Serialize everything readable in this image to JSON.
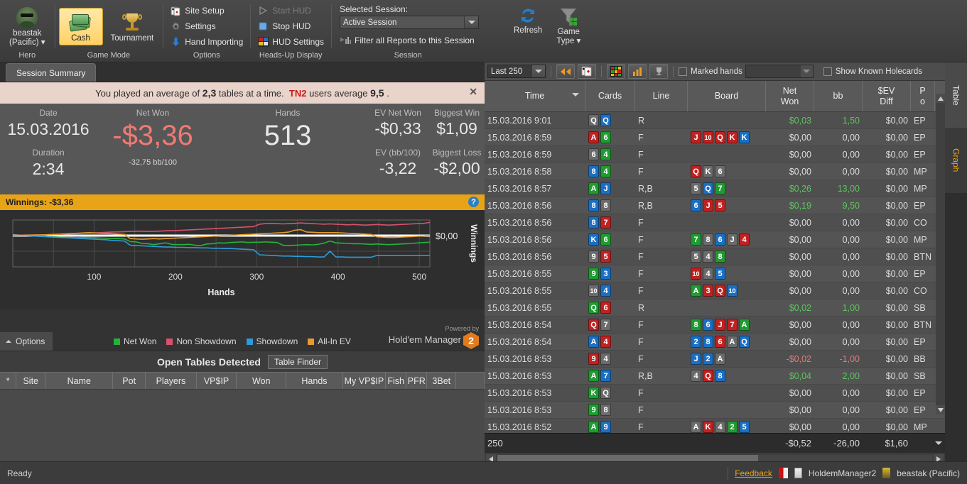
{
  "ribbon": {
    "hero": {
      "name": "beastak",
      "site": "(Pacific)",
      "group": "Hero"
    },
    "game_mode": {
      "group": "Game Mode",
      "cash": "Cash",
      "tournament": "Tournament"
    },
    "options": {
      "group": "Options",
      "site_setup": "Site Setup",
      "settings": "Settings",
      "hand_importing": "Hand Importing"
    },
    "hud": {
      "group": "Heads-Up Display",
      "start": "Start HUD",
      "stop": "Stop HUD",
      "settings": "HUD Settings"
    },
    "session": {
      "group": "Session",
      "selected_label": "Selected Session:",
      "selected_value": "Active Session",
      "filter_label": "Filter all Reports to this Session",
      "refresh": "Refresh",
      "game_type_line1": "Game",
      "game_type_line2": "Type"
    }
  },
  "left": {
    "tab": "Session Summary",
    "notice": {
      "prefix": "You played an average of",
      "avg_tables": "2,3",
      "mid": "tables at a time.",
      "cohort": "TN2",
      "mid2": "users average",
      "cohort_avg": "9,5",
      "suffix": ".",
      "close": "✕"
    },
    "stats": {
      "date_label": "Date",
      "date_value": "15.03.2016",
      "duration_label": "Duration",
      "duration_value": "2:34",
      "netwon_label": "Net Won",
      "netwon_value": "-$3,36",
      "netwon_sub": "-32,75 bb/100",
      "hands_label": "Hands",
      "hands_value": "513",
      "ev_netwon_label": "EV Net Won",
      "ev_netwon_value": "-$0,33",
      "biggest_win_label": "Biggest Win",
      "biggest_win_value": "$1,09",
      "ev_bb_label": "EV (bb/100)",
      "ev_bb_value": "-3,22",
      "biggest_loss_label": "Biggest Loss",
      "biggest_loss_value": "-$2,00"
    },
    "chart_title": "Winnings: -$3,36",
    "chart_help": "?",
    "options_button": "Options",
    "powered_by": "Powered by",
    "hm_name": "Hold'em Manager",
    "hm_badge": "2",
    "tables": {
      "title": "Open Tables Detected",
      "finder_button": "Table Finder",
      "columns": [
        "*",
        "Site",
        "Name",
        "Pot",
        "Players",
        "VP$IP",
        "Won",
        "Hands",
        "My VP$IP",
        "Fish",
        "PFR",
        "3Bet",
        ""
      ],
      "rows": []
    }
  },
  "chart_data": {
    "type": "line",
    "title": "Winnings: -$3,36",
    "xlabel": "Hands",
    "ylabel": "Winnings",
    "xticks": [
      100,
      200,
      300,
      400,
      500
    ],
    "yticks": [
      "$0,00"
    ],
    "xlim": [
      0,
      513
    ],
    "ylim": [
      -5.2,
      2.6
    ],
    "zero_line": 0,
    "grid": true,
    "legend_position": "bottom",
    "series": [
      {
        "name": "Net Won",
        "color": "#25b33c",
        "values": [
          0,
          0.05,
          0.1,
          0.1,
          0.05,
          0,
          -0.15,
          -0.2,
          -0.25,
          -0.3,
          -0.3,
          -0.35,
          -0.3,
          -0.3,
          -0.35,
          -0.4,
          -0.45,
          -0.5,
          -0.5,
          -0.55,
          -1.0,
          -1.05,
          -1.3,
          -1.35,
          -1.5,
          -1.35,
          -1.2,
          -1.45,
          -1.5,
          -1.5,
          -1.45,
          -1.6,
          -1.65,
          -1.4,
          -1.35,
          -1.2,
          -1.25,
          -1.15,
          -1.1,
          -1.05,
          -1.15,
          -1.1,
          -1.1,
          -1.05,
          -1.1,
          -1.15,
          -1.6,
          -1.65,
          -1.6,
          -1.55,
          -1.5,
          -1.55,
          -1.45,
          -1.25,
          -0.9,
          -1.2,
          -1.25,
          -1.3,
          -1.35,
          -1.35,
          -1.4,
          -1.45,
          -1.4,
          -1.45,
          -1.5,
          -1.45,
          -1.4,
          -1.35,
          -1.3,
          -1.2,
          -1.15,
          -1.1
        ]
      },
      {
        "name": "Non Showdown",
        "color": "#d6536a",
        "values": [
          0,
          0.05,
          0.08,
          0.1,
          0.12,
          0.1,
          0.15,
          0.2,
          0.22,
          0.25,
          0.3,
          0.35,
          0.4,
          0.42,
          0.45,
          0.5,
          0.55,
          0.6,
          0.62,
          0.65,
          0.7,
          0.72,
          0.75,
          0.7,
          0.72,
          0.75,
          0.8,
          0.82,
          0.85,
          0.9,
          0.95,
          1.0,
          1.05,
          1.1,
          1.15,
          1.2,
          1.25,
          1.3,
          1.35,
          1.4,
          1.45,
          1.5,
          1.9,
          2.0,
          2.05,
          2.0,
          1.95,
          2.0,
          2.05,
          2.1,
          2.05,
          2.0,
          1.95,
          1.9,
          1.95,
          1.9,
          1.85,
          1.8,
          1.85,
          1.8,
          1.75,
          1.8,
          1.85,
          1.8,
          1.75,
          1.8,
          1.85,
          1.9,
          1.95,
          2.0,
          2.05,
          2.2
        ]
      },
      {
        "name": "Showdown",
        "color": "#2e9bd8",
        "values": [
          0,
          0,
          0,
          -0.05,
          -0.1,
          -0.15,
          -0.2,
          -0.25,
          -0.3,
          -0.35,
          -0.4,
          -0.45,
          -0.5,
          -0.55,
          -0.6,
          -0.65,
          -0.7,
          -0.8,
          -0.85,
          -0.9,
          -1.6,
          -1.65,
          -1.7,
          -1.75,
          -1.8,
          -1.85,
          -1.9,
          -1.9,
          -1.95,
          -1.95,
          -2.0,
          -2.0,
          -2.05,
          -2.05,
          -2.1,
          -2.1,
          -2.15,
          -2.15,
          -2.2,
          -2.25,
          -2.3,
          -2.35,
          -3.2,
          -3.25,
          -3.3,
          -3.35,
          -3.4,
          -3.4,
          -3.45,
          -3.45,
          -3.5,
          -3.5,
          -3.55,
          -3.55,
          -2.6,
          -3.55,
          -3.55,
          -3.6,
          -3.6,
          -3.6,
          -3.6,
          -3.6,
          -3.3,
          -3.3,
          -3.3,
          -3.3,
          -3.3,
          -3.3,
          -3.3,
          -3.3,
          -3.3,
          -3.3
        ]
      },
      {
        "name": "All-In EV",
        "color": "#e59b2e",
        "values": [
          0,
          0.02,
          0.05,
          0.08,
          0.1,
          0.12,
          0.15,
          0.2,
          0.25,
          0.3,
          0.35,
          0.4,
          0.45,
          0.5,
          0.45,
          0.4,
          0.35,
          0.3,
          0.25,
          0.2,
          -0.5,
          -0.55,
          -0.6,
          -0.55,
          -0.5,
          -0.55,
          -0.5,
          -0.45,
          -0.4,
          -0.35,
          -0.3,
          -0.25,
          -0.2,
          -0.15,
          -0.1,
          -0.05,
          0,
          0.05,
          0.1,
          0.15,
          0.2,
          0.25,
          0.3,
          0.35,
          0.4,
          0.45,
          0.5,
          0.6,
          0.9,
          1.0,
          0.6,
          0.55,
          0.5,
          0.5,
          0.5,
          0.5,
          0.45,
          0.4,
          0.35,
          0.3,
          0.25,
          0.2,
          -0.2,
          -0.25,
          -0.3,
          -0.3,
          -0.25,
          -0.2,
          -0.15,
          -0.1,
          -0.05,
          0.05
        ]
      }
    ]
  },
  "right": {
    "toolbar": {
      "range_value": "Last 250",
      "marked_hands_label": "Marked hands",
      "marked_hands_value": "",
      "show_known_holecards_label": "Show Known Holecards",
      "icons": [
        "rewind-icon",
        "cards-icon",
        "grid-icon",
        "bar-chart-icon",
        "trophy-icon"
      ]
    },
    "columns": [
      {
        "label": "Time",
        "sorted": true
      },
      {
        "label": "Cards"
      },
      {
        "label": "Line"
      },
      {
        "label": "Board"
      },
      {
        "label": "Net\nWon",
        "l1": "Net",
        "l2": "Won"
      },
      {
        "label": "bb"
      },
      {
        "label": "$EV\nDiff",
        "l1": "$EV",
        "l2": "Diff"
      },
      {
        "label": "P\no",
        "l1": "P",
        "l2": "o"
      }
    ],
    "rows": [
      {
        "time": "15.03.2016 9:01",
        "cards": [
          [
            "Q",
            "s"
          ],
          [
            "Q",
            "d"
          ]
        ],
        "line": "R",
        "board": [],
        "net": "$0,03",
        "net_sign": "pos",
        "bb": "1,50",
        "bb_sign": "pos",
        "ev": "$0,00",
        "pos": "EP"
      },
      {
        "time": "15.03.2016 8:59",
        "cards": [
          [
            "A",
            "h"
          ],
          [
            "6",
            "c"
          ]
        ],
        "line": "F",
        "board": [
          [
            "J",
            "h"
          ],
          [
            "10",
            "h"
          ],
          [
            "Q",
            "h"
          ],
          [
            "K",
            "h"
          ],
          [
            "K",
            "d"
          ]
        ],
        "net": "$0,00",
        "net_sign": "",
        "bb": "0,00",
        "bb_sign": "",
        "ev": "$0,00",
        "pos": "EP"
      },
      {
        "time": "15.03.2016 8:59",
        "cards": [
          [
            "6",
            "s"
          ],
          [
            "4",
            "c"
          ]
        ],
        "line": "F",
        "board": [],
        "net": "$0,00",
        "net_sign": "",
        "bb": "0,00",
        "bb_sign": "",
        "ev": "$0,00",
        "pos": "EP"
      },
      {
        "time": "15.03.2016 8:58",
        "cards": [
          [
            "8",
            "d"
          ],
          [
            "4",
            "c"
          ]
        ],
        "line": "F",
        "board": [
          [
            "Q",
            "h"
          ],
          [
            "K",
            "s"
          ],
          [
            "6",
            "s"
          ]
        ],
        "net": "$0,00",
        "net_sign": "",
        "bb": "0,00",
        "bb_sign": "",
        "ev": "$0,00",
        "pos": "MP"
      },
      {
        "time": "15.03.2016 8:57",
        "cards": [
          [
            "A",
            "c"
          ],
          [
            "J",
            "d"
          ]
        ],
        "line": "R,B",
        "board": [
          [
            "5",
            "s"
          ],
          [
            "Q",
            "d"
          ],
          [
            "7",
            "c"
          ]
        ],
        "net": "$0,26",
        "net_sign": "pos",
        "bb": "13,00",
        "bb_sign": "pos",
        "ev": "$0,00",
        "pos": "MP"
      },
      {
        "time": "15.03.2016 8:56",
        "cards": [
          [
            "8",
            "d"
          ],
          [
            "8",
            "s"
          ]
        ],
        "line": "R,B",
        "board": [
          [
            "6",
            "d"
          ],
          [
            "J",
            "h"
          ],
          [
            "5",
            "h"
          ]
        ],
        "net": "$0,19",
        "net_sign": "pos",
        "bb": "9,50",
        "bb_sign": "pos",
        "ev": "$0,00",
        "pos": "EP"
      },
      {
        "time": "15.03.2016 8:56",
        "cards": [
          [
            "8",
            "d"
          ],
          [
            "7",
            "h"
          ]
        ],
        "line": "F",
        "board": [],
        "net": "$0,00",
        "net_sign": "",
        "bb": "0,00",
        "bb_sign": "",
        "ev": "$0,00",
        "pos": "CO"
      },
      {
        "time": "15.03.2016 8:56",
        "cards": [
          [
            "K",
            "d"
          ],
          [
            "6",
            "c"
          ]
        ],
        "line": "F",
        "board": [
          [
            "7",
            "c"
          ],
          [
            "8",
            "s"
          ],
          [
            "6",
            "d"
          ],
          [
            "J",
            "s"
          ],
          [
            "4",
            "h"
          ]
        ],
        "net": "$0,00",
        "net_sign": "",
        "bb": "0,00",
        "bb_sign": "",
        "ev": "$0,00",
        "pos": "MP"
      },
      {
        "time": "15.03.2016 8:56",
        "cards": [
          [
            "9",
            "s"
          ],
          [
            "5",
            "h"
          ]
        ],
        "line": "F",
        "board": [
          [
            "5",
            "s"
          ],
          [
            "4",
            "s"
          ],
          [
            "8",
            "c"
          ]
        ],
        "net": "$0,00",
        "net_sign": "",
        "bb": "0,00",
        "bb_sign": "",
        "ev": "$0,00",
        "pos": "BTN"
      },
      {
        "time": "15.03.2016 8:55",
        "cards": [
          [
            "9",
            "c"
          ],
          [
            "3",
            "d"
          ]
        ],
        "line": "F",
        "board": [
          [
            "10",
            "h"
          ],
          [
            "4",
            "s"
          ],
          [
            "5",
            "d"
          ]
        ],
        "net": "$0,00",
        "net_sign": "",
        "bb": "0,00",
        "bb_sign": "",
        "ev": "$0,00",
        "pos": "EP"
      },
      {
        "time": "15.03.2016 8:55",
        "cards": [
          [
            "10",
            "s"
          ],
          [
            "4",
            "d"
          ]
        ],
        "line": "F",
        "board": [
          [
            "A",
            "c"
          ],
          [
            "3",
            "h"
          ],
          [
            "Q",
            "h"
          ],
          [
            "10",
            "d"
          ]
        ],
        "net": "$0,00",
        "net_sign": "",
        "bb": "0,00",
        "bb_sign": "",
        "ev": "$0,00",
        "pos": "CO"
      },
      {
        "time": "15.03.2016 8:55",
        "cards": [
          [
            "Q",
            "c"
          ],
          [
            "6",
            "h"
          ]
        ],
        "line": "R",
        "board": [],
        "net": "$0,02",
        "net_sign": "pos",
        "bb": "1,00",
        "bb_sign": "pos",
        "ev": "$0,00",
        "pos": "SB"
      },
      {
        "time": "15.03.2016 8:54",
        "cards": [
          [
            "Q",
            "h"
          ],
          [
            "7",
            "s"
          ]
        ],
        "line": "F",
        "board": [
          [
            "8",
            "c"
          ],
          [
            "6",
            "d"
          ],
          [
            "J",
            "h"
          ],
          [
            "7",
            "h"
          ],
          [
            "A",
            "c"
          ]
        ],
        "net": "$0,00",
        "net_sign": "",
        "bb": "0,00",
        "bb_sign": "",
        "ev": "$0,00",
        "pos": "BTN"
      },
      {
        "time": "15.03.2016 8:54",
        "cards": [
          [
            "A",
            "d"
          ],
          [
            "4",
            "h"
          ]
        ],
        "line": "F",
        "board": [
          [
            "2",
            "d"
          ],
          [
            "8",
            "d"
          ],
          [
            "6",
            "h"
          ],
          [
            "A",
            "s"
          ],
          [
            "Q",
            "d"
          ]
        ],
        "net": "$0,00",
        "net_sign": "",
        "bb": "0,00",
        "bb_sign": "",
        "ev": "$0,00",
        "pos": "EP"
      },
      {
        "time": "15.03.2016 8:53",
        "cards": [
          [
            "9",
            "h"
          ],
          [
            "4",
            "s"
          ]
        ],
        "line": "F",
        "board": [
          [
            "J",
            "d"
          ],
          [
            "2",
            "d"
          ],
          [
            "A",
            "s"
          ]
        ],
        "net": "-$0,02",
        "net_sign": "neg",
        "bb": "-1,00",
        "bb_sign": "neg",
        "ev": "$0,00",
        "pos": "BB"
      },
      {
        "time": "15.03.2016 8:53",
        "cards": [
          [
            "A",
            "c"
          ],
          [
            "7",
            "d"
          ]
        ],
        "line": "R,B",
        "board": [
          [
            "4",
            "s"
          ],
          [
            "Q",
            "h"
          ],
          [
            "8",
            "d"
          ]
        ],
        "net": "$0,04",
        "net_sign": "pos",
        "bb": "2,00",
        "bb_sign": "pos",
        "ev": "$0,00",
        "pos": "SB"
      },
      {
        "time": "15.03.2016 8:53",
        "cards": [
          [
            "K",
            "c"
          ],
          [
            "Q",
            "s"
          ]
        ],
        "line": "F",
        "board": [],
        "net": "$0,00",
        "net_sign": "",
        "bb": "0,00",
        "bb_sign": "",
        "ev": "$0,00",
        "pos": "EP"
      },
      {
        "time": "15.03.2016 8:53",
        "cards": [
          [
            "9",
            "c"
          ],
          [
            "8",
            "s"
          ]
        ],
        "line": "F",
        "board": [],
        "net": "$0,00",
        "net_sign": "",
        "bb": "0,00",
        "bb_sign": "",
        "ev": "$0,00",
        "pos": "EP"
      },
      {
        "time": "15.03.2016 8:52",
        "cards": [
          [
            "A",
            "c"
          ],
          [
            "9",
            "d"
          ]
        ],
        "line": "F",
        "board": [
          [
            "A",
            "s"
          ],
          [
            "K",
            "h"
          ],
          [
            "4",
            "s"
          ],
          [
            "2",
            "c"
          ],
          [
            "5",
            "d"
          ]
        ],
        "net": "$0,00",
        "net_sign": "",
        "bb": "0,00",
        "bb_sign": "",
        "ev": "$0,00",
        "pos": "MP"
      }
    ],
    "summary": {
      "count": "250",
      "net": "-$0,52",
      "bb": "-26,00",
      "ev": "$1,60"
    },
    "side_tabs": {
      "table": "Table",
      "graph": "Graph"
    }
  },
  "status": {
    "ready": "Ready",
    "feedback": "Feedback",
    "app": "HoldemManager2",
    "user": "beastak (Pacific)"
  }
}
